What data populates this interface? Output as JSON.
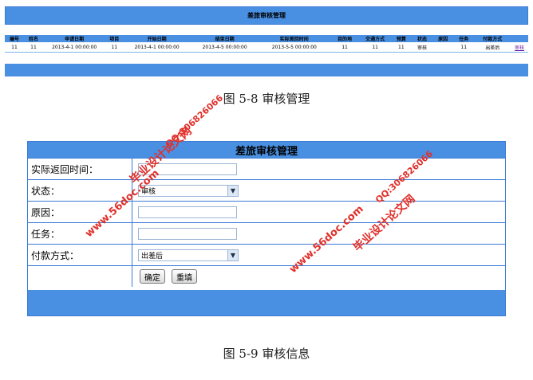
{
  "list": {
    "title": "差旅审核管理",
    "columns": [
      "编号",
      "姓名",
      "申请日期",
      "项目",
      "开始日期",
      "结束日期",
      "实际差回时间",
      "目的地",
      "交通方式",
      "预算",
      "状态",
      "原因",
      "任务",
      "付款方式",
      ""
    ],
    "rows": [
      [
        "11",
        "11",
        "2013-4-1 00:00:00",
        "11",
        "2013-4-1 00:00:00",
        "2013-4-5 00:00:00",
        "2013-5-5 00:00:00",
        "11",
        "11",
        "11",
        "审核",
        "",
        "11",
        "出差后",
        "审核"
      ]
    ]
  },
  "captions": {
    "fig1": "图 5-8 审核管理",
    "fig2": "图 5-9 审核信息"
  },
  "form": {
    "title": "差旅审核管理",
    "return_time_label": "实际返回时间：",
    "return_time_value": "",
    "status_label": "状态：",
    "status_value": "审核",
    "reason_label": "原因：",
    "reason_value": "",
    "task_label": "任务：",
    "task_value": "",
    "payment_label": "付款方式：",
    "payment_value": "出差后",
    "confirm_label": "确定",
    "reset_label": "重填"
  },
  "watermarks": {
    "site_cn": "毕业设计论文网",
    "url": "www.56doc.com",
    "qq": "QQ:306826066"
  },
  "colors": {
    "header_blue": "#4a90e2",
    "border_blue": "#3a7bd5",
    "watermark_red": "#e0302b",
    "link_purple": "#6a1b9a"
  }
}
